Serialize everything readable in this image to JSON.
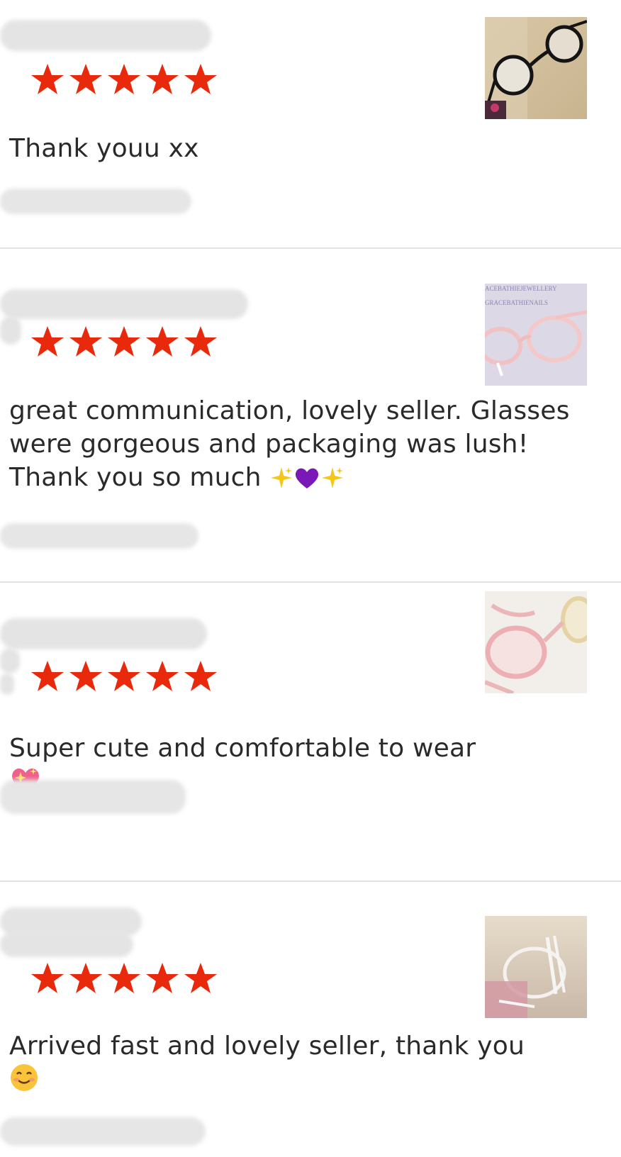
{
  "reviews": [
    {
      "rating": 5,
      "text": "Thank youu xx",
      "photo": "black-round-glasses-photo"
    },
    {
      "rating": 5,
      "text": "great communication, lovely seller. Glasses were gorgeous and packaging was lush! Thank you so much",
      "photo": "pink-glasses-photo",
      "photo_watermark_1": "ACEBATHIEJEWELLERY",
      "photo_watermark_2": "GRACEBATHIENAILS"
    },
    {
      "rating": 5,
      "text": "Super cute and comfortable to wear",
      "photo": "pink-and-gold-glasses-photo"
    },
    {
      "rating": 5,
      "text": "Arrived fast and lovely seller,  thank you",
      "photo": "clear-glasses-photo"
    }
  ],
  "colors": {
    "star": "#e8290b",
    "divider": "#e2e2e2",
    "text": "#2a2a2a",
    "redaction": "#e4e4e4"
  }
}
